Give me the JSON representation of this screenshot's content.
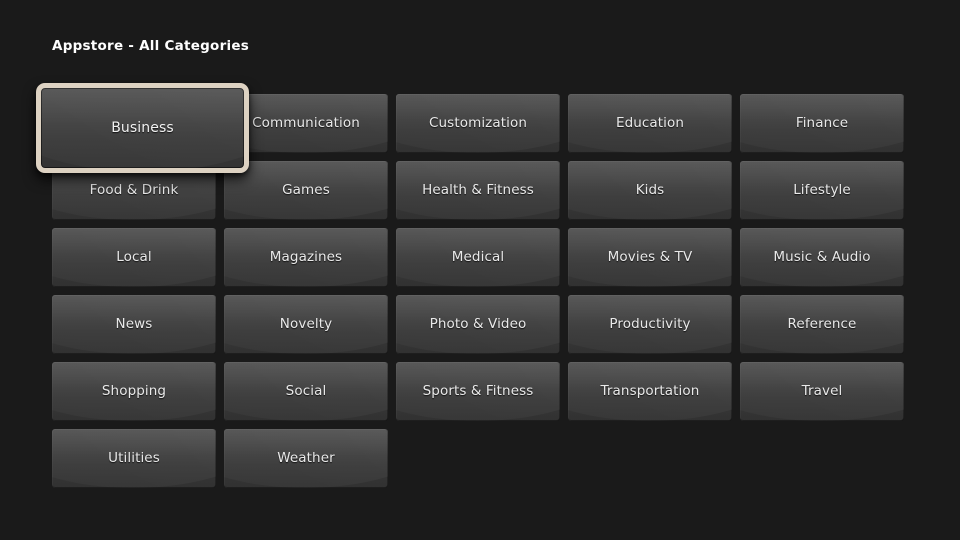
{
  "header": {
    "title": "Appstore - All Categories"
  },
  "theme": {
    "background": "#1a1a1a",
    "tile_top": "#4b4b4b",
    "tile_bottom": "#313131",
    "label_color": "#e9e9e9",
    "selection_border": "#ddd2c2",
    "header_color": "#ffffff"
  },
  "grid": {
    "columns": 5,
    "selected_index": 0,
    "tiles": [
      {
        "label": "Business",
        "selected": true
      },
      {
        "label": "Communication",
        "selected": false
      },
      {
        "label": "Customization",
        "selected": false
      },
      {
        "label": "Education",
        "selected": false
      },
      {
        "label": "Finance",
        "selected": false
      },
      {
        "label": "Food & Drink",
        "selected": false
      },
      {
        "label": "Games",
        "selected": false
      },
      {
        "label": "Health & Fitness",
        "selected": false
      },
      {
        "label": "Kids",
        "selected": false
      },
      {
        "label": "Lifestyle",
        "selected": false
      },
      {
        "label": "Local",
        "selected": false
      },
      {
        "label": "Magazines",
        "selected": false
      },
      {
        "label": "Medical",
        "selected": false
      },
      {
        "label": "Movies & TV",
        "selected": false
      },
      {
        "label": "Music & Audio",
        "selected": false
      },
      {
        "label": "News",
        "selected": false
      },
      {
        "label": "Novelty",
        "selected": false
      },
      {
        "label": "Photo & Video",
        "selected": false
      },
      {
        "label": "Productivity",
        "selected": false
      },
      {
        "label": "Reference",
        "selected": false
      },
      {
        "label": "Shopping",
        "selected": false
      },
      {
        "label": "Social",
        "selected": false
      },
      {
        "label": "Sports & Fitness",
        "selected": false
      },
      {
        "label": "Transportation",
        "selected": false
      },
      {
        "label": "Travel",
        "selected": false
      },
      {
        "label": "Utilities",
        "selected": false
      },
      {
        "label": "Weather",
        "selected": false
      }
    ]
  }
}
